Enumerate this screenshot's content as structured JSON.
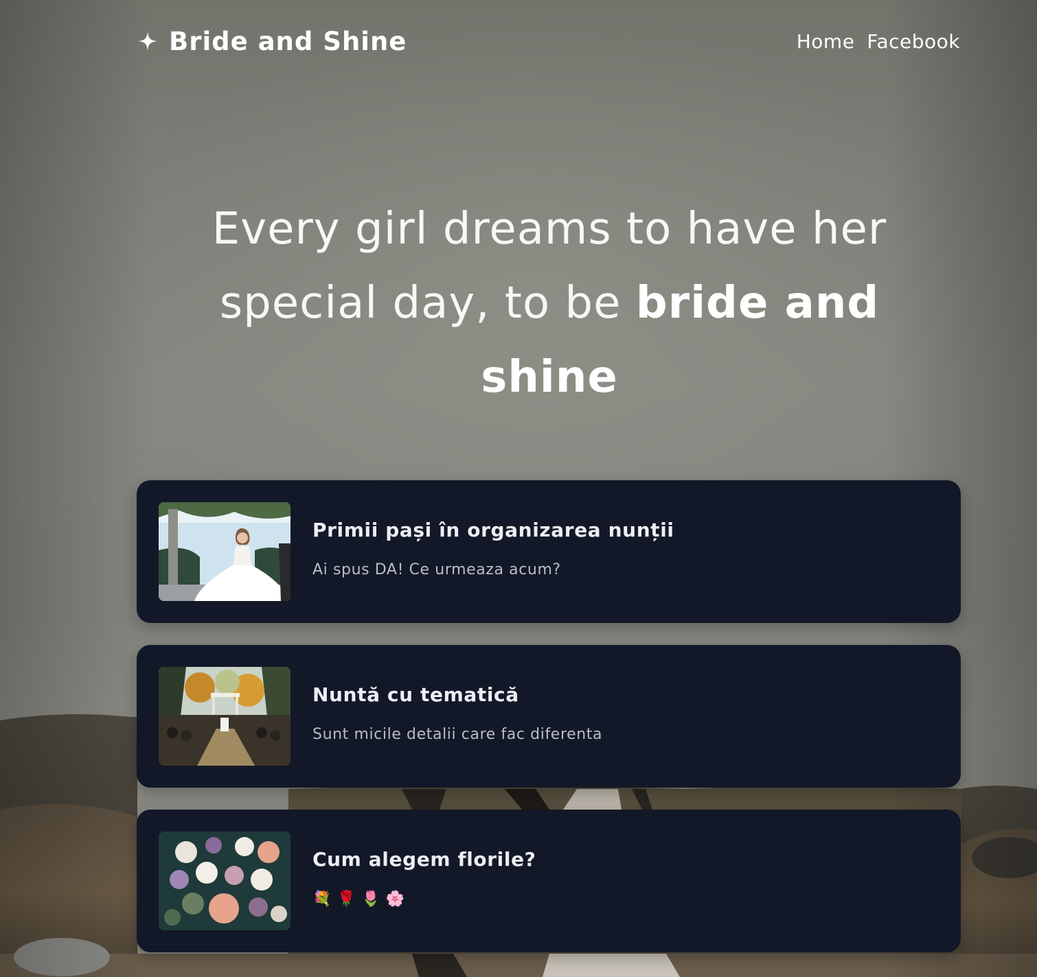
{
  "header": {
    "brand_icon": "sparkle-icon",
    "brand_name": "Bride and Shine",
    "nav": [
      {
        "label": "Home"
      },
      {
        "label": "Facebook"
      }
    ]
  },
  "hero": {
    "line_light": "Every girl dreams to have her special day, to be",
    "line_bold": "bride and shine"
  },
  "posts": [
    {
      "image": "bride-in-white-dress-photo",
      "title": "Primii pași în organizarea nunții",
      "subtitle": "Ai spus DA! Ce urmeaza acum?"
    },
    {
      "image": "outdoor-ceremony-aisle-photo",
      "title": "Nuntă cu tematică",
      "subtitle": "Sunt micile detalii care fac diferenta"
    },
    {
      "image": "flower-bouquet-photo",
      "title": "Cum alegem florile?",
      "subtitle": "💐 🌹 🌷 🌸"
    }
  ],
  "colors": {
    "card_background": "#131828",
    "text_primary": "#ffffff",
    "text_muted": "#b9bdc8"
  }
}
